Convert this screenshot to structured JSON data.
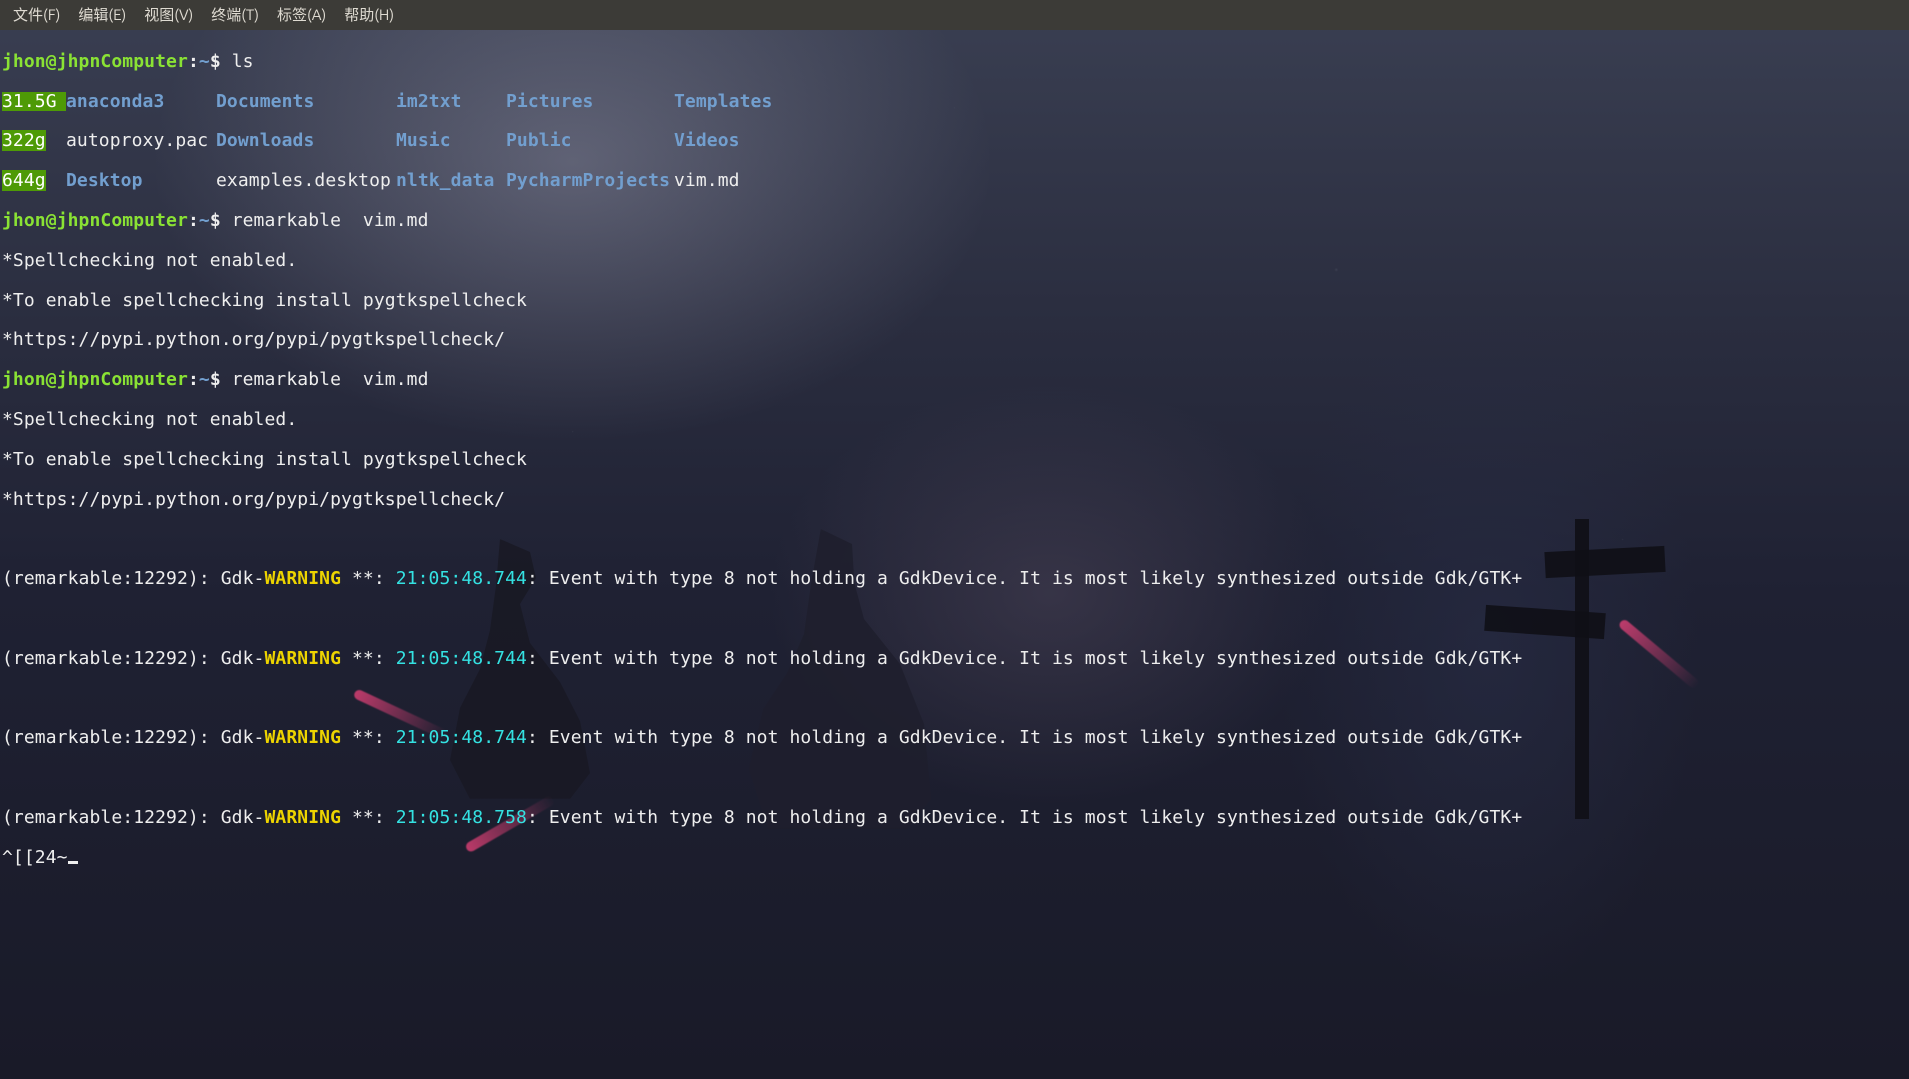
{
  "menubar": {
    "items": [
      "文件(F)",
      "编辑(E)",
      "视图(V)",
      "终端(T)",
      "标签(A)",
      "帮助(H)"
    ]
  },
  "prompt": {
    "user": "jhon",
    "host": "jhpnComputer",
    "sep_uh": "@",
    "colon": ":",
    "path_prefix": "~",
    "dollar": "$"
  },
  "commands": {
    "ls": "ls",
    "remarkable1": "remarkable  vim.md",
    "remarkable2": "remarkable  vim.md"
  },
  "ls_output": {
    "row0": {
      "size": "31.5G",
      "c1": "anaconda3",
      "c2": "Documents",
      "c3": "im2txt",
      "c4": "Pictures",
      "c5": "Templates"
    },
    "row1": {
      "size": "322g",
      "c1": "autoproxy.pac",
      "c2": "Downloads",
      "c3": "Music",
      "c4": "Public",
      "c5": "Videos"
    },
    "row2": {
      "size": "644g",
      "c1": "Desktop",
      "c2": "examples.desktop",
      "c3": "nltk_data",
      "c4": "PycharmProjects",
      "c5": "vim.md"
    }
  },
  "spell": {
    "l1": "*Spellchecking not enabled.",
    "l2": "*To enable spellchecking install pygtkspellcheck",
    "l3": "*https://pypi.python.org/pypi/pygtkspellcheck/"
  },
  "gdk": {
    "prefix": "(remarkable:12292): Gdk-",
    "warn": "WARNING",
    "stars": " **: ",
    "ts1": "21:05:48.744",
    "ts2": "21:05:48.744",
    "ts3": "21:05:48.744",
    "ts4": "21:05:48.758",
    "msg": ": Event with type 8 not holding a GdkDevice. It is most likely synthesized outside Gdk/GTK+"
  },
  "trailing_input": "^[[24~"
}
